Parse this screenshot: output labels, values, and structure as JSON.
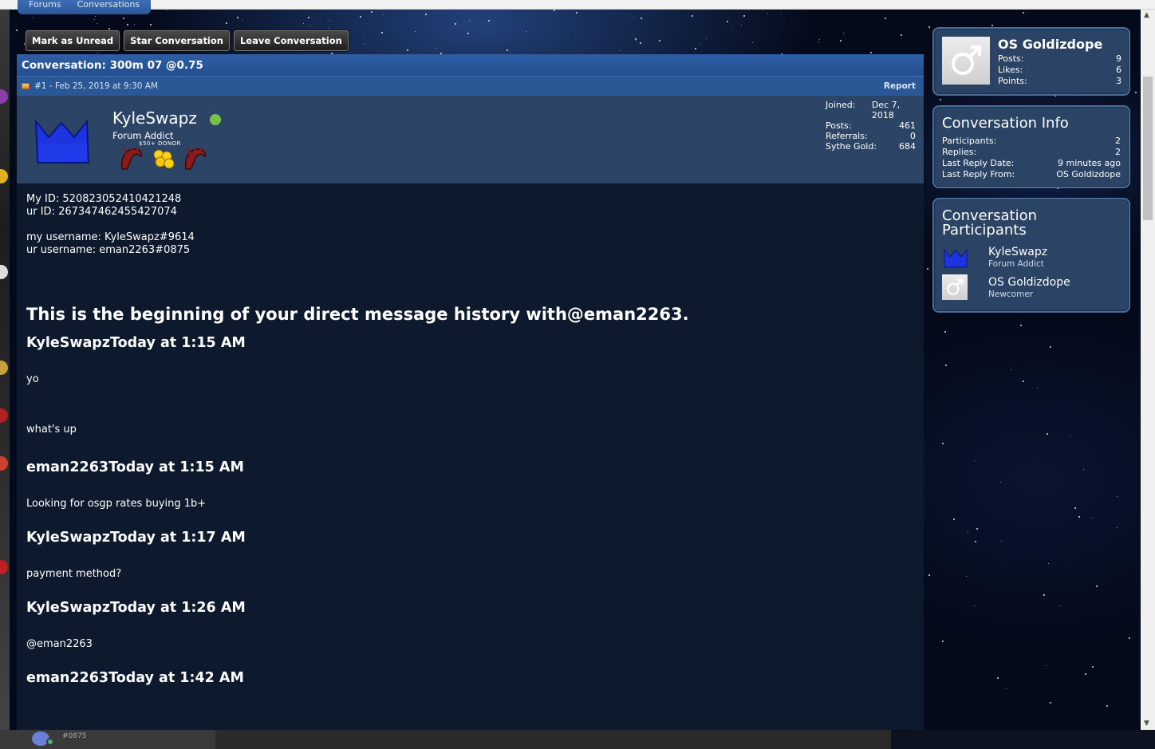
{
  "breadcrumb": [
    "Forums",
    "Conversations"
  ],
  "actions": {
    "mark_unread": "Mark as Unread",
    "star": "Star Conversation",
    "leave": "Leave Conversation"
  },
  "conversation": {
    "title": "Conversation: 300m 07 @0.75",
    "post_meta": "#1 - Feb 25, 2019 at 9:30 AM",
    "report": "Report",
    "author": {
      "name": "KyleSwapz",
      "title": "Forum Addict",
      "donor": "$50+ DONOR",
      "stats": [
        {
          "label": "Joined:",
          "value": "Dec 7, 2018"
        },
        {
          "label": "Posts:",
          "value": "461"
        },
        {
          "label": "Referrals:",
          "value": "0"
        },
        {
          "label": "Sythe Gold:",
          "value": "684"
        }
      ]
    },
    "body": {
      "my_id": "My ID: 520823052410421248",
      "ur_id": "ur ID: 267347462455427074",
      "my_username": "my username: KyleSwapz#9614",
      "ur_username": "ur username: eman2263#0875",
      "history": "This is the beginning of your direct message history with@eman2263.",
      "m1_head": "KyleSwapzToday at 1:15 AM",
      "m1_a": "yo",
      "m1_b": "what's up",
      "m2_head": "eman2263Today at 1:15 AM",
      "m2_a": "Looking for osgp rates buying 1b+",
      "m3_head": "KyleSwapzToday at 1:17 AM",
      "m3_a": "payment method?",
      "m4_head": "KyleSwapzToday at 1:26 AM",
      "m4_a": "@eman2263",
      "m5_head": "eman2263Today at 1:42 AM"
    }
  },
  "sidebar": {
    "profile": {
      "name": "OS Goldizdope",
      "rows": [
        {
          "label": "Posts:",
          "value": "9"
        },
        {
          "label": "Likes:",
          "value": "6"
        },
        {
          "label": "Points:",
          "value": "3"
        }
      ]
    },
    "info": {
      "title": "Conversation Info",
      "rows": [
        {
          "label": "Participants:",
          "value": "2"
        },
        {
          "label": "Replies:",
          "value": "2"
        },
        {
          "label": "Last Reply Date:",
          "value": "9 minutes ago"
        },
        {
          "label": "Last Reply From:",
          "value": "OS Goldizdope"
        }
      ]
    },
    "participants": {
      "title": "Conversation Participants",
      "people": [
        {
          "name": "KyleSwapz",
          "title": "Forum Addict"
        },
        {
          "name": "OS Goldizdope",
          "title": "Newcomer"
        }
      ]
    }
  },
  "taskbar": {
    "tag": "#0875"
  },
  "colors": {
    "accent": "#2a5896",
    "online": "#7ac143",
    "panel": "#2b4466"
  }
}
